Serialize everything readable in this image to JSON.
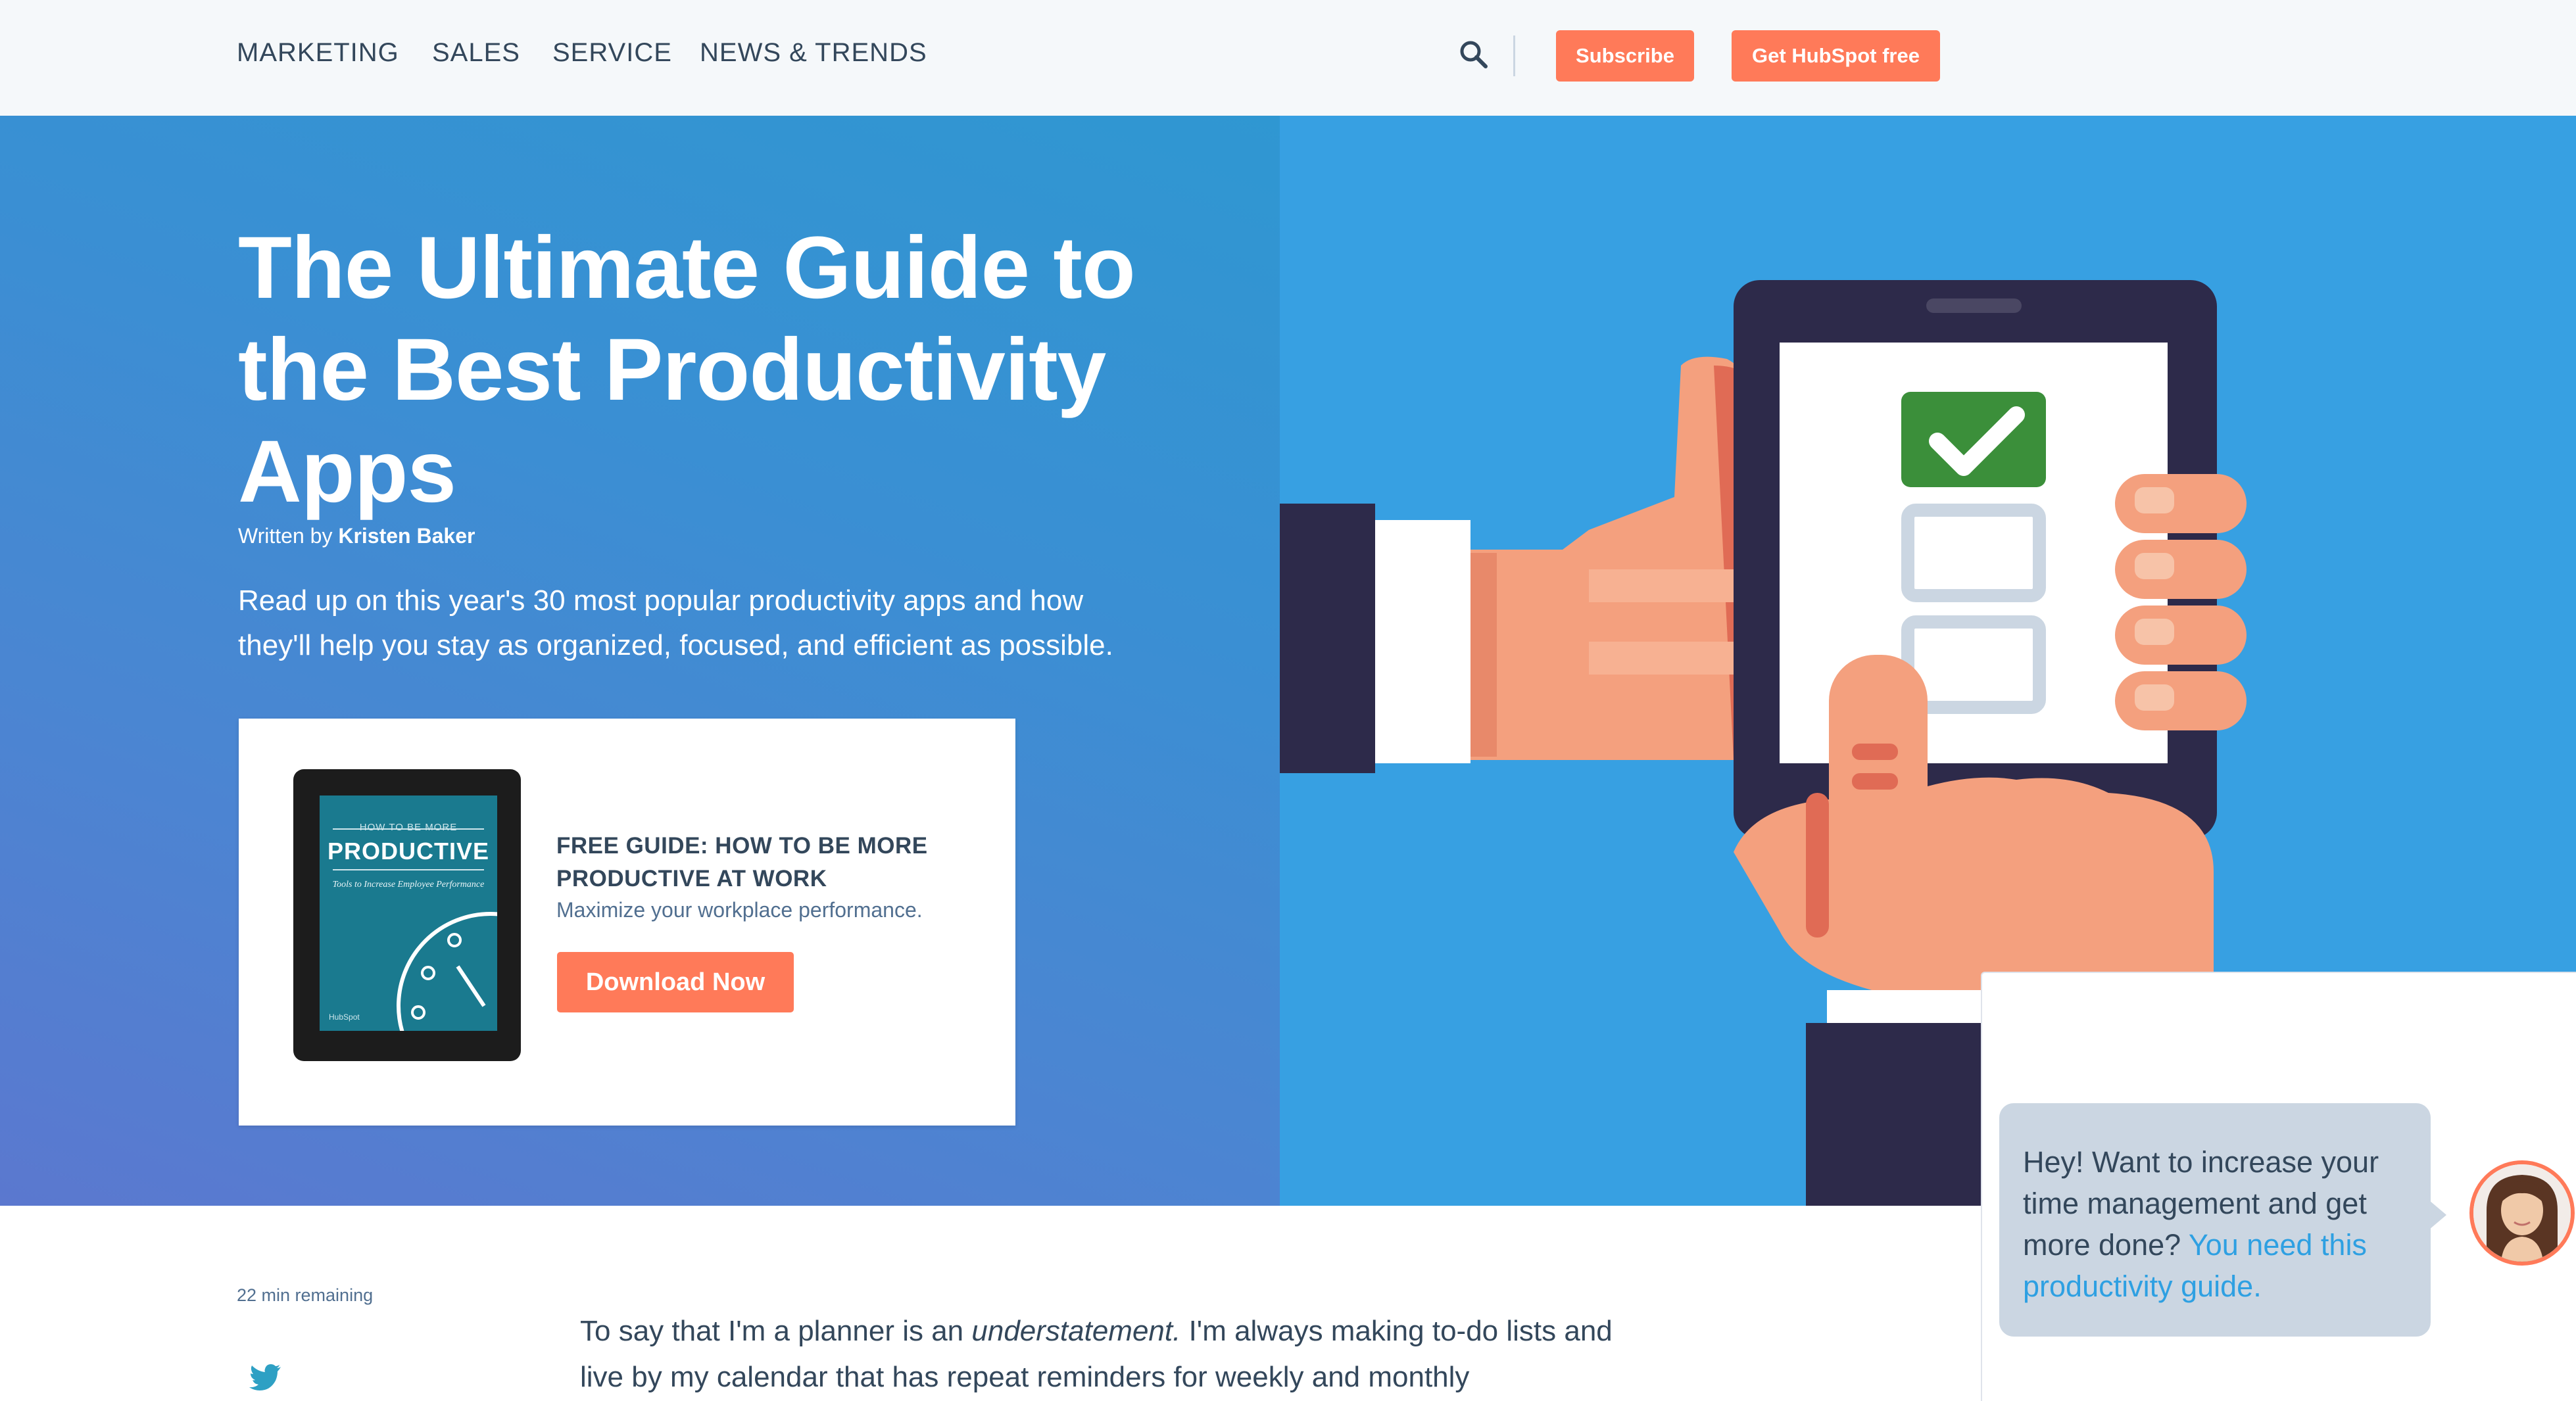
{
  "nav": {
    "items": [
      {
        "label": "MARKETING"
      },
      {
        "label": "SALES"
      },
      {
        "label": "SERVICE"
      },
      {
        "label": "NEWS & TRENDS"
      }
    ],
    "search_icon": "search-icon",
    "subscribe_label": "Subscribe",
    "get_hubspot_label": "Get HubSpot free"
  },
  "hero": {
    "title": "The Ultimate Guide to the Best Productivity Apps",
    "byline_prefix": "Written by ",
    "author": "Kristen Baker",
    "intro": "Read up on this year's 30 most popular productivity apps and how they'll help you stay as organized, focused, and efficient as possible.",
    "illustration_icon": "hand-holding-phone-checklist-icon"
  },
  "cta": {
    "ebook_kicker": "HOW TO BE MORE",
    "ebook_title": "PRODUCTIVE",
    "ebook_subtitle": "Tools to Increase Employee Performance",
    "ebook_brand": "HubSpot",
    "heading": "FREE GUIDE: HOW TO BE MORE PRODUCTIVE AT WORK",
    "subheading": "Maximize your workplace performance.",
    "button_label": "Download Now"
  },
  "article": {
    "read_time": "22 min remaining",
    "p1_before": "To say that I'm a planner is an ",
    "p1_em": "understatement.",
    "p1_after": " I'm always making to-do lists and live by my calendar that has repeat reminders for weekly and monthly",
    "share_icon": "twitter-icon"
  },
  "chat": {
    "message": "Hey! Want to increase your time management and get more done? ",
    "link_text": "You need this productivity guide.",
    "avatar_icon": "avatar-icon"
  },
  "colors": {
    "accent": "#ff7a59",
    "header_bg": "#f5f8fa",
    "hero_right_bg": "#37a0e2",
    "text_dark": "#33475b",
    "link": "#2ea0e2"
  }
}
